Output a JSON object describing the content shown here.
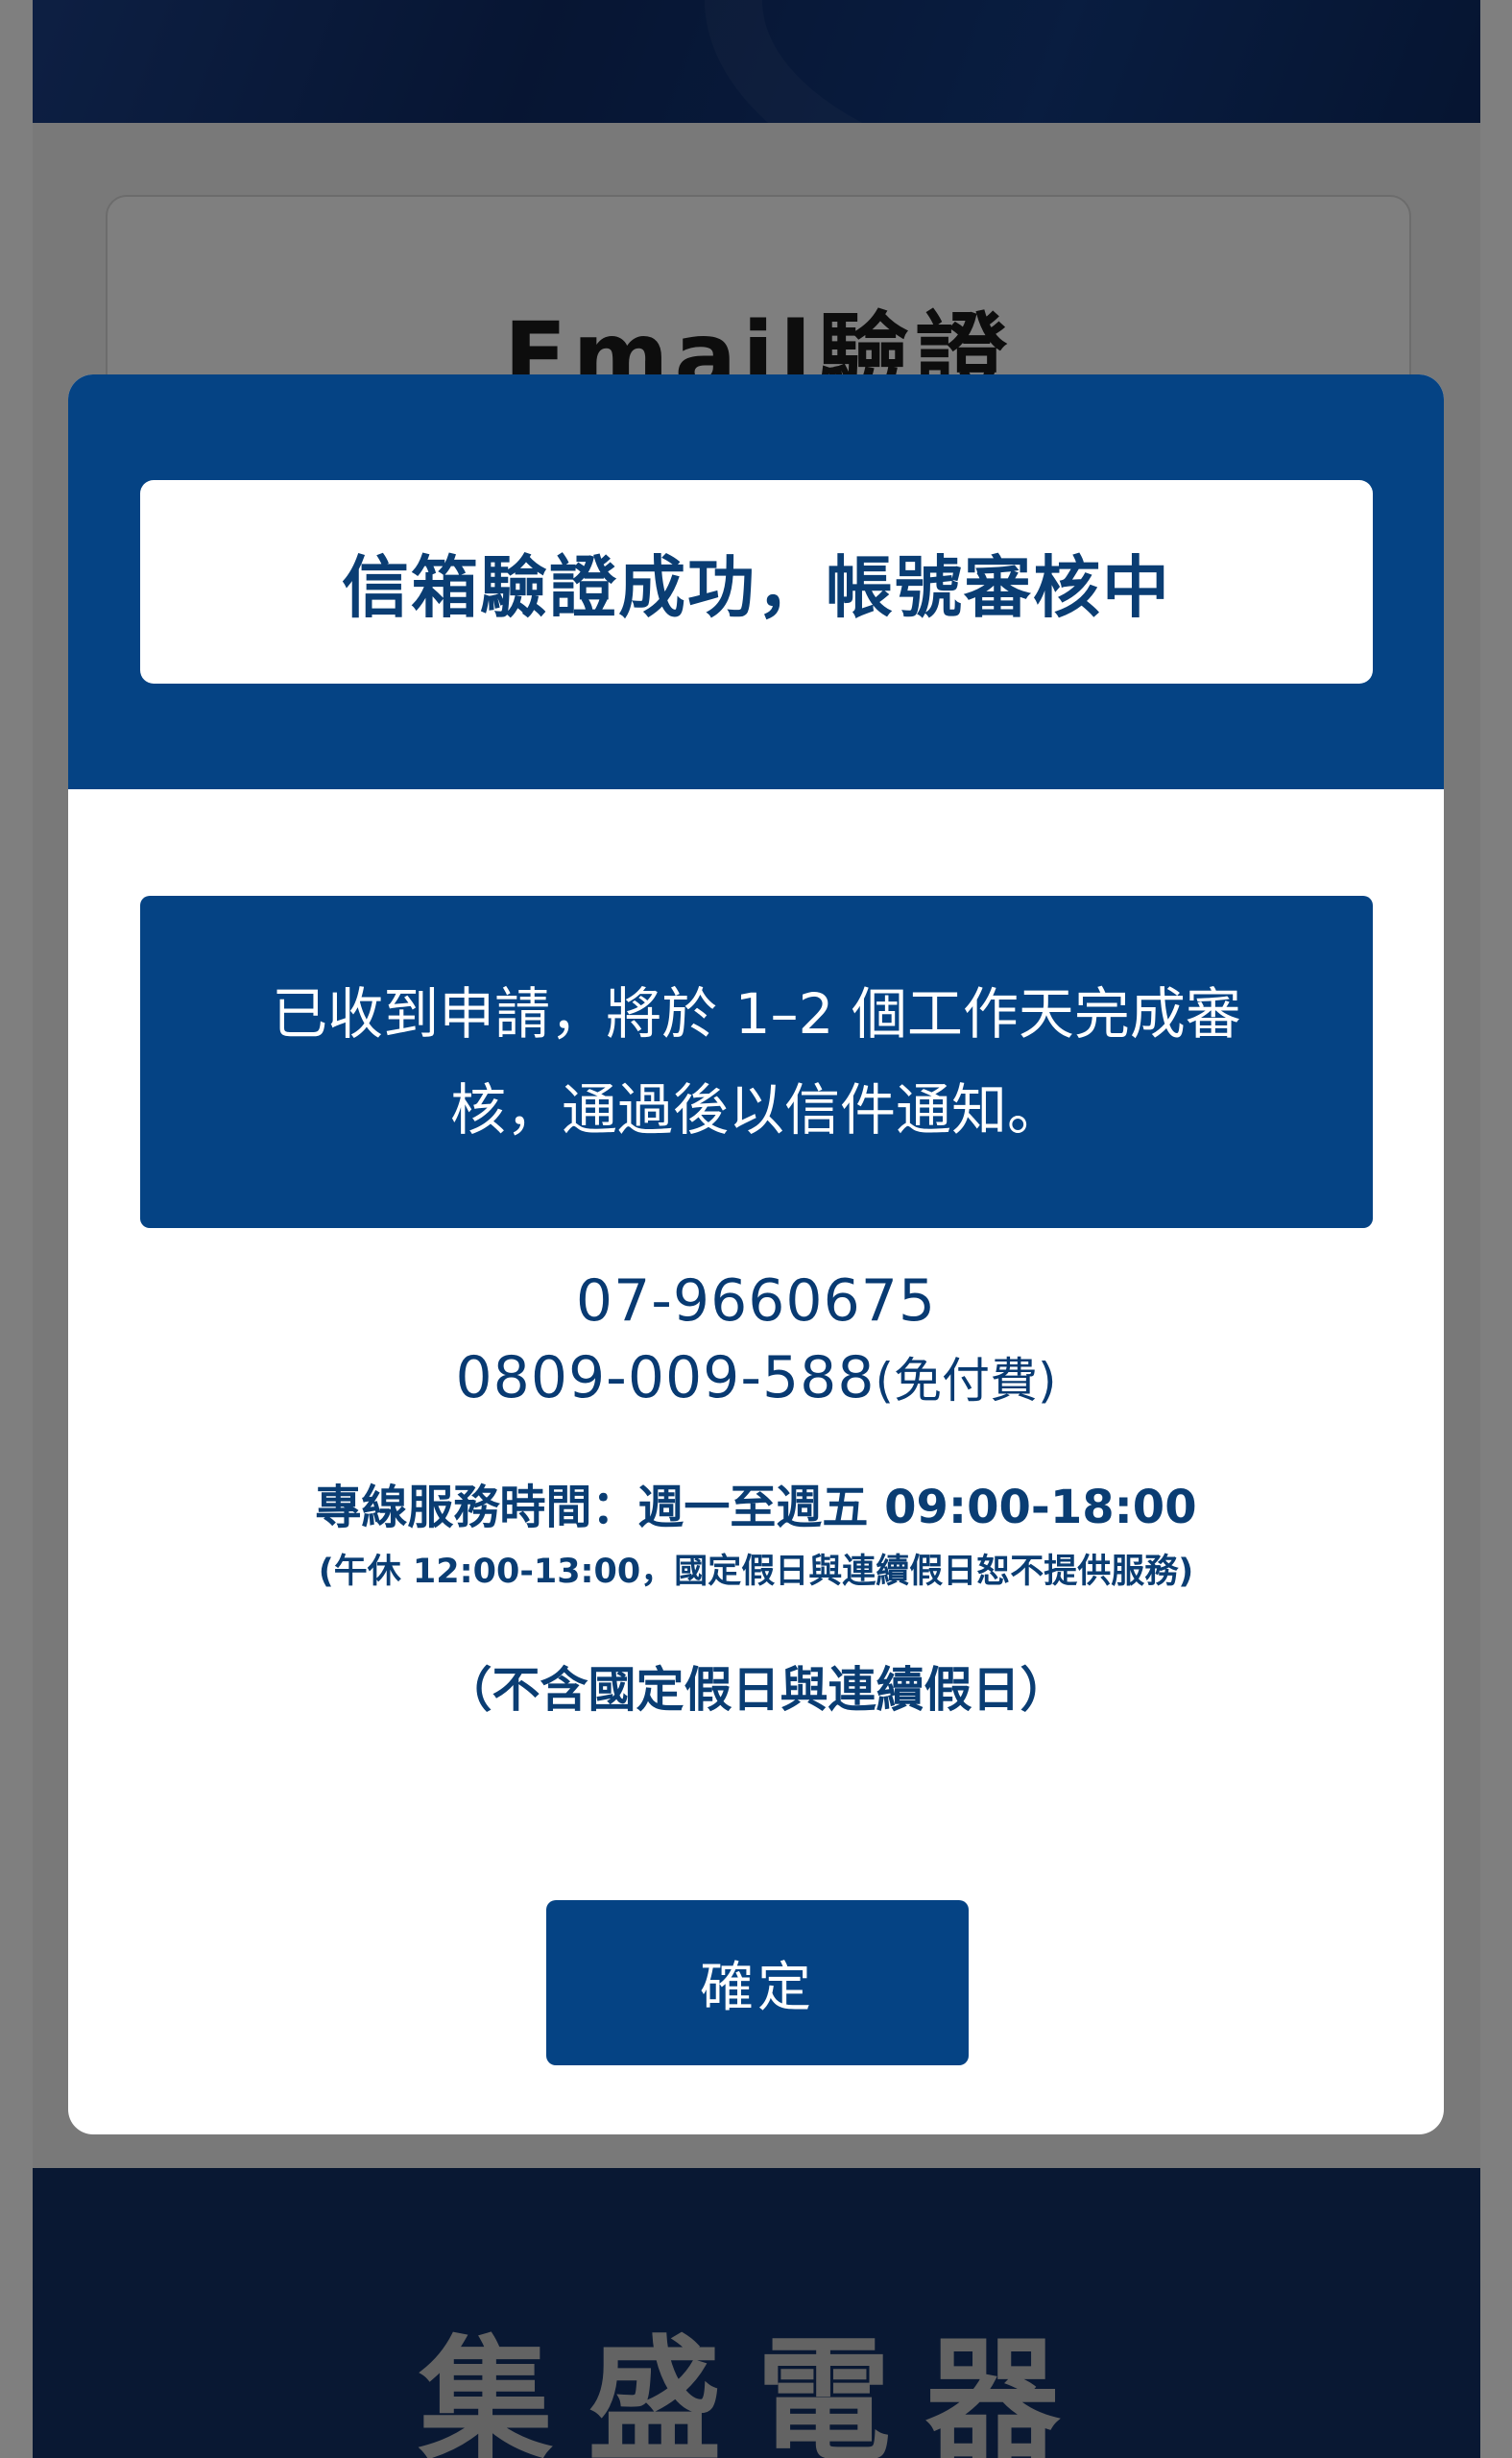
{
  "background_page": {
    "card_title": "Email驗證",
    "footer_logo": "集盛電器"
  },
  "modal": {
    "header_title": "信箱驗證成功，帳號審核中",
    "notice": {
      "line1": "已收到申請，將於 1–2 個工作天完成審",
      "line2": "核，通過後以信件通知。"
    },
    "contact": {
      "phone1": "07-9660675",
      "phone2": "0809-009-588",
      "phone2_note": "(免付費)"
    },
    "service_hours": "專線服務時間：週一至週五 09:00-18:00",
    "service_hours_note": "(午休 12:00-13:00，國定假日與連續假日恕不提供服務)",
    "holiday_note": "（不含國定假日與連續假日）",
    "confirm_label": "確定"
  },
  "colors": {
    "primary": "#054384",
    "text_primary": "#0a3d73",
    "overlay": "rgba(0,0,0,0.5)"
  }
}
